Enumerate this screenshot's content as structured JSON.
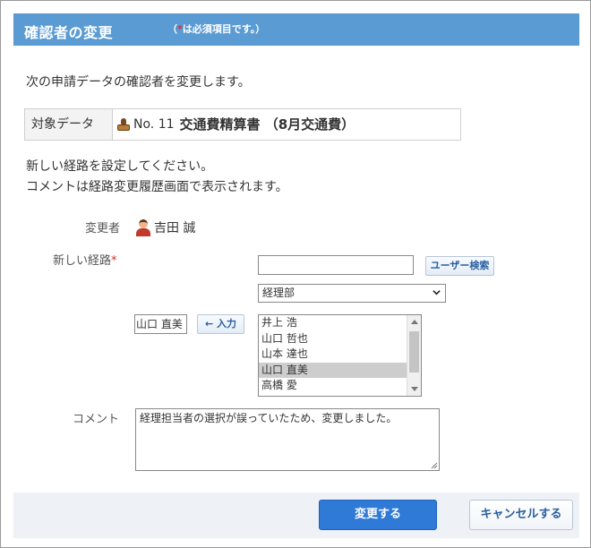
{
  "header": {
    "title": "確認者の変更",
    "note_open": "（",
    "note_star": "*",
    "note_text": "は必須項目です。）"
  },
  "intro": "次の申請データの確認者を変更します。",
  "target": {
    "label": "対象データ",
    "icon": "stamp-icon",
    "number": "No. 11",
    "title": "交通費精算書 （8月交通費）"
  },
  "desc": {
    "line1": "新しい経路を設定してください。",
    "line2": "コメントは経路変更履歴画面で表示されます。"
  },
  "form": {
    "changer_label": "変更者",
    "changer_name": "吉田 誠",
    "route_label": "新しい経路",
    "required_mark": "*",
    "search_value": "",
    "search_button": "ユーザー検索",
    "department": "経理部",
    "selected_user": "山口 直美",
    "input_button": "← 入力",
    "users": [
      {
        "name": "井上 浩",
        "selected": false
      },
      {
        "name": "山口 哲也",
        "selected": false
      },
      {
        "name": "山本 達也",
        "selected": false
      },
      {
        "name": "山口 直美",
        "selected": true
      },
      {
        "name": "高橋 愛",
        "selected": false
      }
    ],
    "comment_label": "コメント",
    "comment_value": "経理担当者の選択が誤っていたため、変更しました。"
  },
  "footer": {
    "submit": "変更する",
    "cancel": "キャンセルする"
  },
  "colors": {
    "header": "#5b9bd3",
    "primary": "#2f7ad6",
    "required": "#d92b2b"
  }
}
